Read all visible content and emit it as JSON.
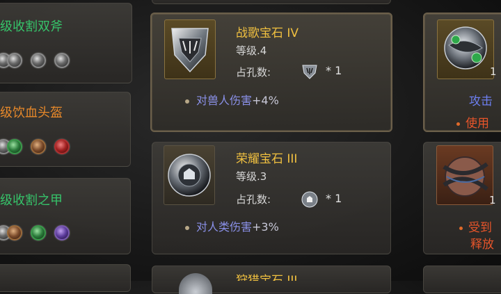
{
  "left_column": [
    {
      "name": "级收割双斧",
      "color": "#36c46a"
    },
    {
      "name": "级饮血头盔",
      "color": "#e8892a"
    },
    {
      "name": "级收割之甲",
      "color": "#36c46a"
    }
  ],
  "gems": [
    {
      "name": "战歌宝石 IV",
      "level": "等级.4",
      "slots_label": "占孔数:",
      "slots_count": "* 1",
      "effect_name": "对兽人伤害",
      "effect_value": "+4%",
      "icon": "shield-crest-gem"
    },
    {
      "name": "荣耀宝石 III",
      "level": "等级.3",
      "slots_label": "占孔数:",
      "slots_count": "* 1",
      "effect_name": "对人类伤害",
      "effect_value": "+3%",
      "icon": "round-crest-gem"
    },
    {
      "name": "狩猎宝石 III"
    }
  ],
  "right_column": {
    "card1": {
      "qty": "1",
      "line1": "攻击",
      "line2": "使用"
    },
    "card2": {
      "qty": "1",
      "line1": "受到",
      "line2": "释放"
    }
  },
  "colors": {
    "gold": "#f0c040",
    "effect": "#8a90e8",
    "orange_text": "#e8552a",
    "blue_text": "#6d7ff0"
  }
}
